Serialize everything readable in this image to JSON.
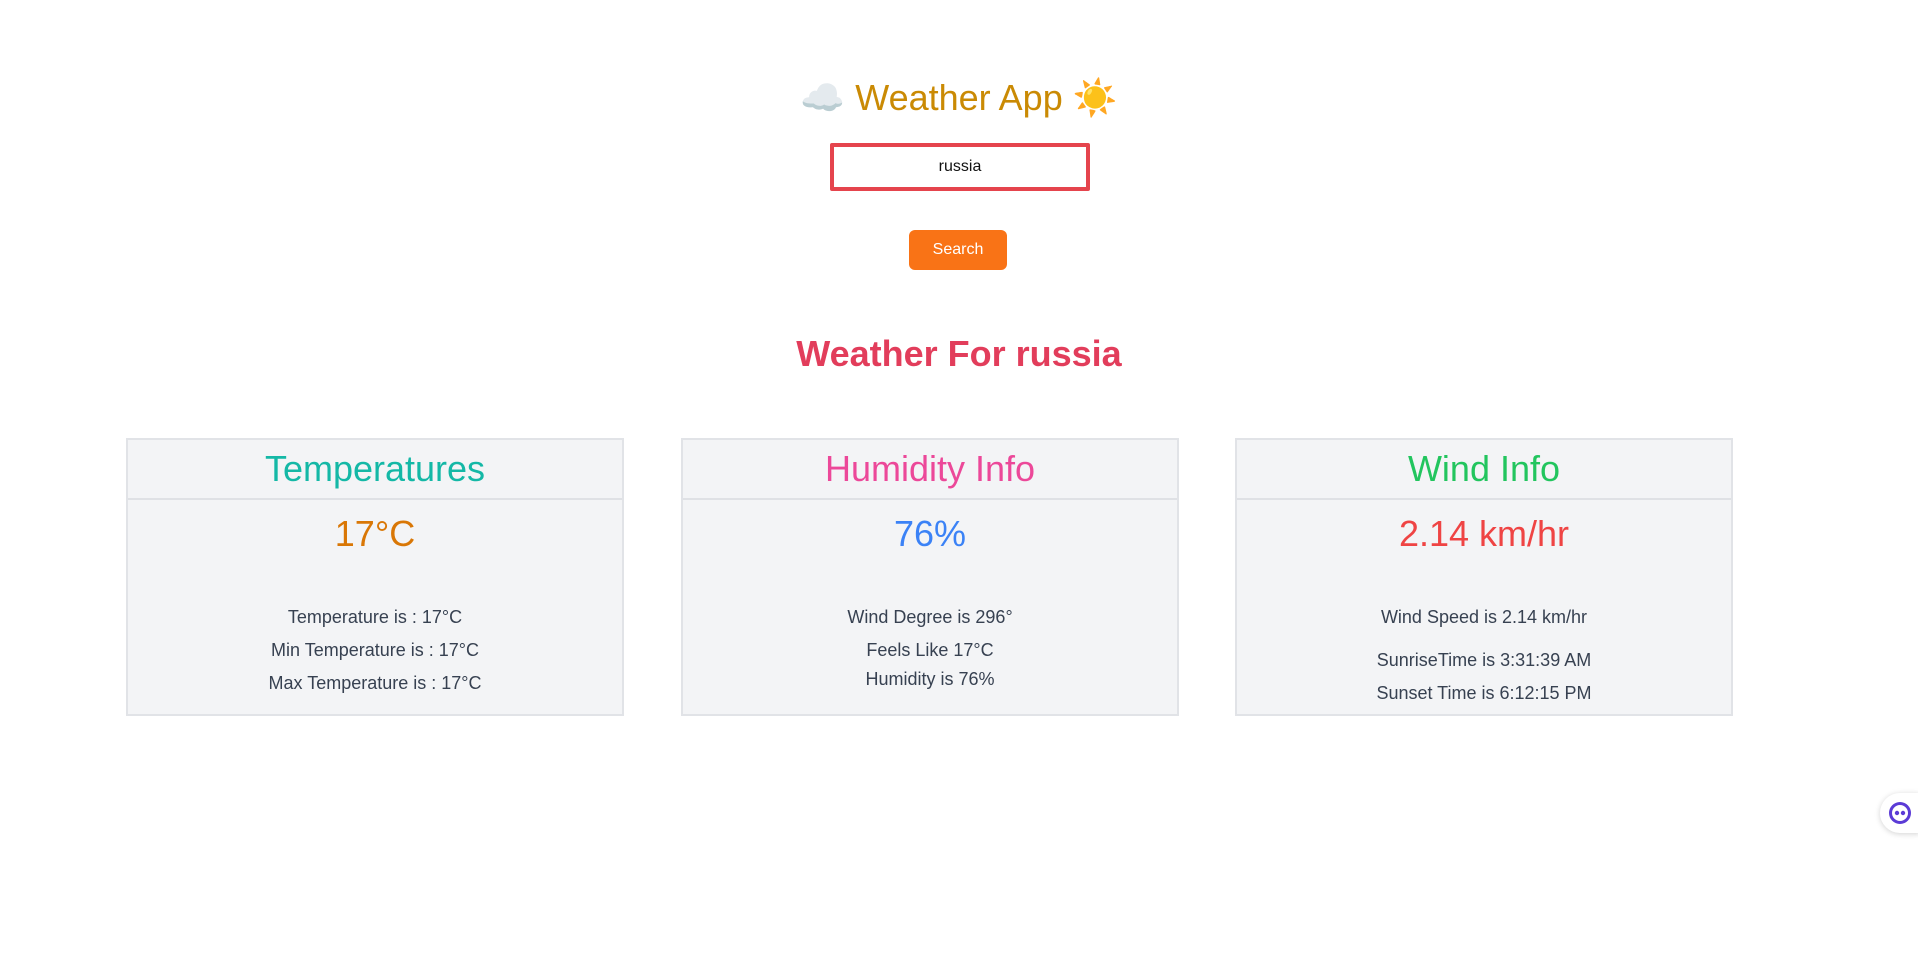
{
  "header": {
    "title": "Weather App",
    "title_emoji_left": "☁️",
    "title_emoji_right": "☀️"
  },
  "search": {
    "value": "russia",
    "button_label": "Search"
  },
  "result": {
    "heading": "Weather For russia"
  },
  "cards": {
    "temperature": {
      "title": "Temperatures",
      "value": "17°C",
      "lines": [
        "Temperature is : 17°C",
        "Min Temperature is : 17°C",
        "Max Temperature is : 17°C"
      ]
    },
    "humidity": {
      "title": "Humidity Info",
      "value": "76%",
      "lines": [
        "Wind Degree is 296°",
        "Feels Like 17°C",
        "Humidity is 76%"
      ]
    },
    "wind": {
      "title": "Wind Info",
      "value": "2.14 km/hr",
      "lines": [
        "Wind Speed is 2.14 km/hr",
        "SunriseTime is 3:31:39 AM",
        "Sunset Time is 6:12:15 PM"
      ]
    }
  },
  "colors": {
    "title": "#ca8a04",
    "search_border": "#e5444d",
    "button_bg": "#f97316",
    "heading": "#e23d5b",
    "temperature_title": "#14b8a6",
    "humidity_title": "#ec4899",
    "wind_title": "#22c55e",
    "temperature_value": "#d97706",
    "humidity_value": "#3b82f6",
    "wind_value": "#ef4444"
  },
  "icons": {
    "assistant": "assistant-bot-icon"
  }
}
